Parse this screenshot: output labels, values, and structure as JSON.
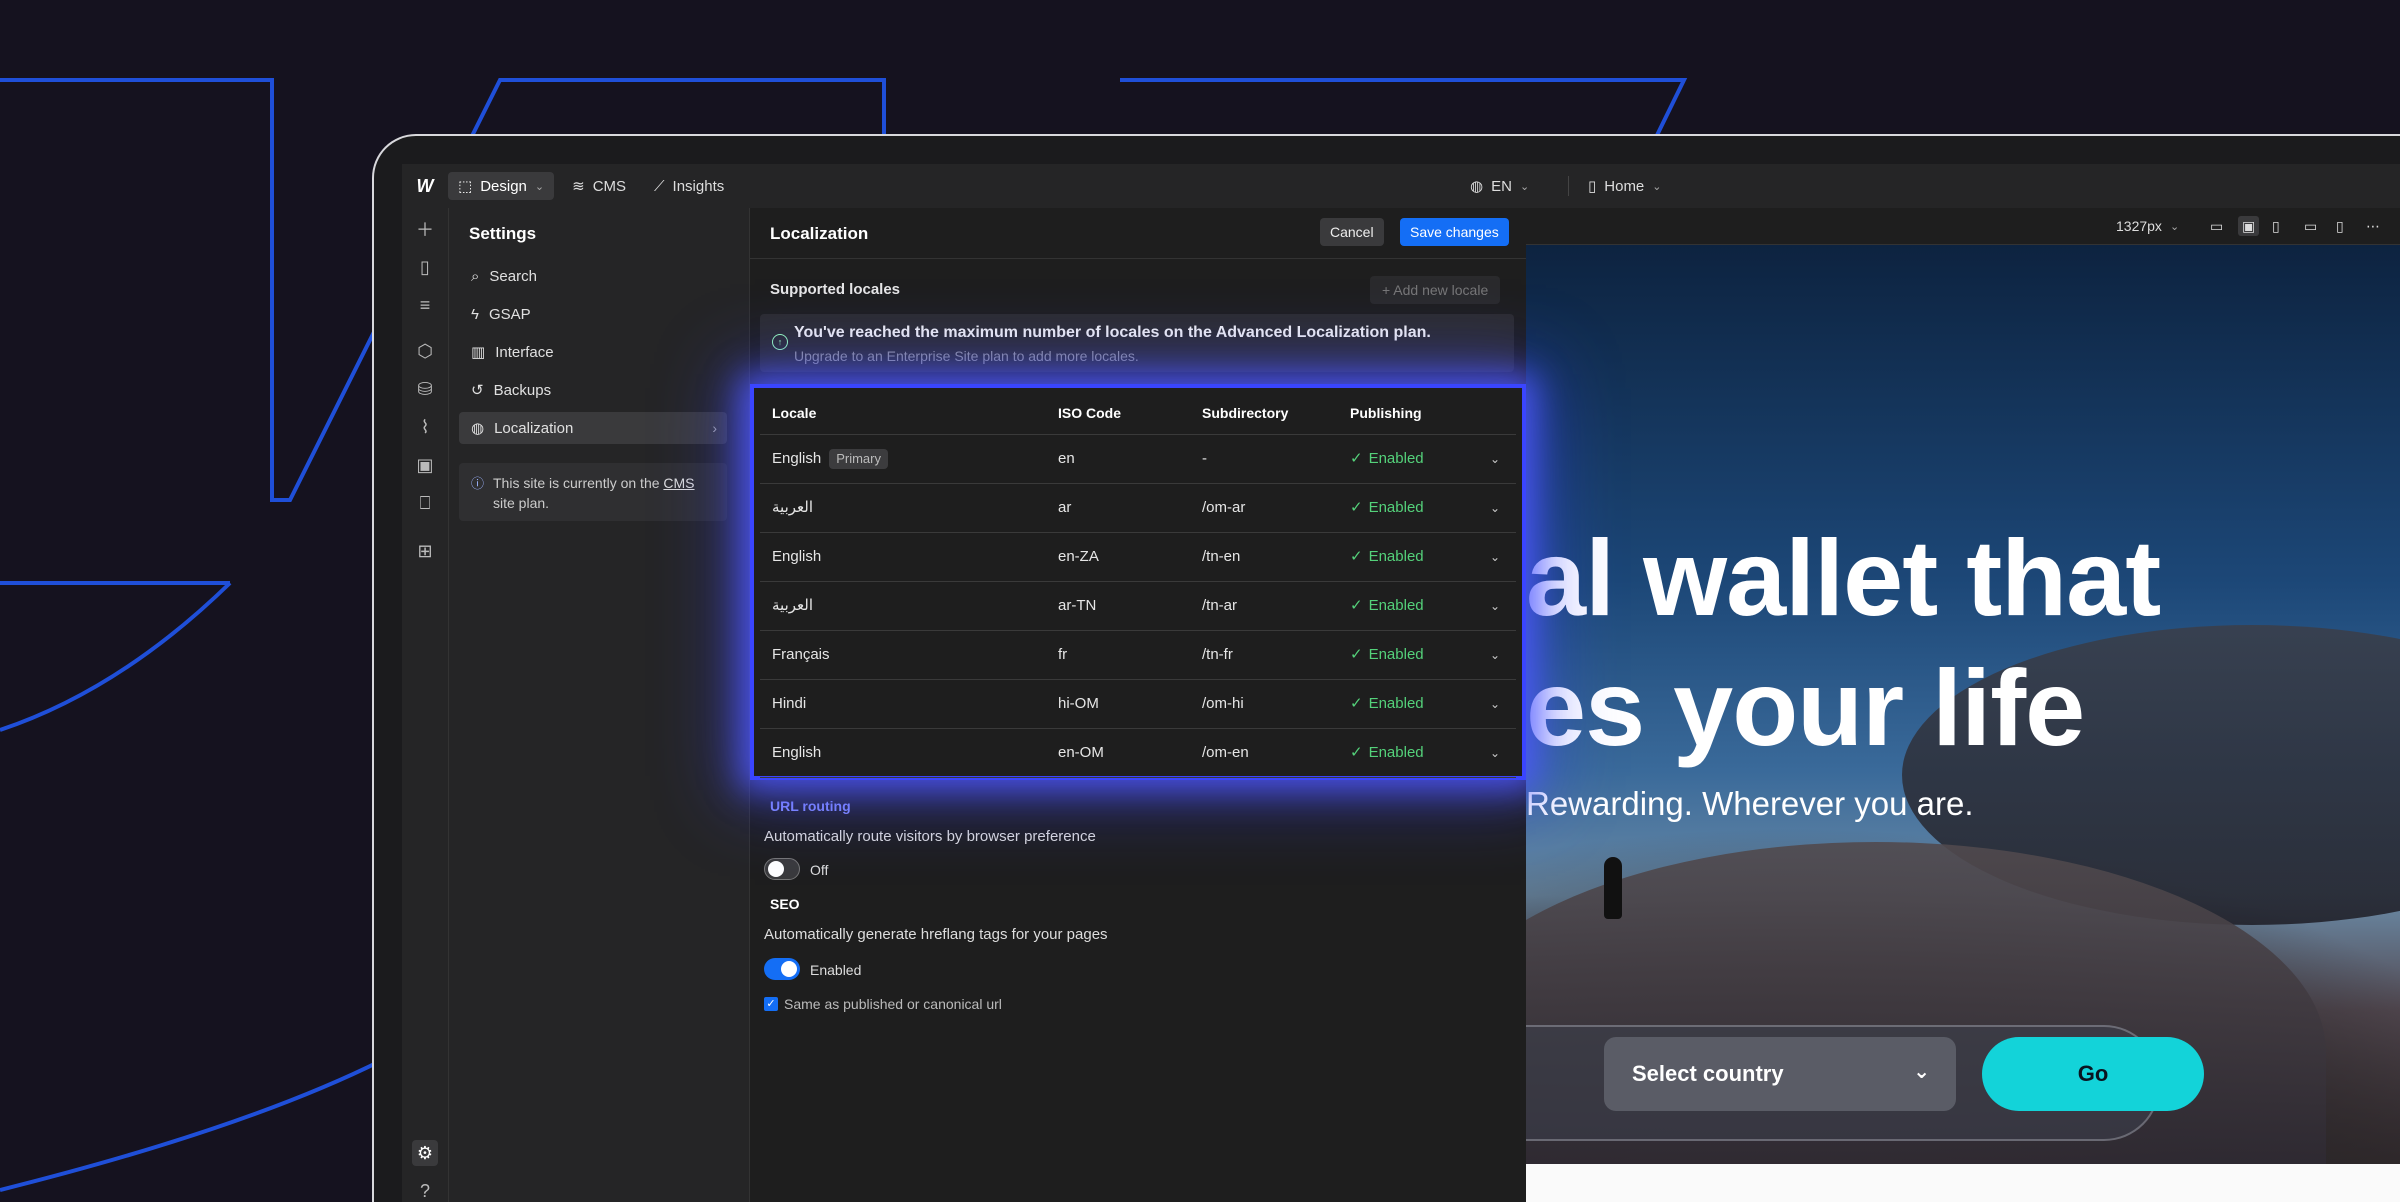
{
  "topbar": {
    "logo": "W",
    "design_label": "Design",
    "cms_label": "CMS",
    "insights_label": "Insights",
    "locale_label": "EN",
    "page_label": "Home"
  },
  "settings": {
    "title": "Settings",
    "items": [
      {
        "label": "Search"
      },
      {
        "label": "GSAP"
      },
      {
        "label": "Interface"
      },
      {
        "label": "Backups"
      },
      {
        "label": "Localization"
      }
    ],
    "notice_pre": "This site is currently on the ",
    "notice_link": "CMS",
    "notice_post": " site plan."
  },
  "localization": {
    "title": "Localization",
    "cancel_label": "Cancel",
    "save_label": "Save changes",
    "supported_label": "Supported locales",
    "add_locale_label": "+ Add new locale",
    "warning_title": "You've reached the maximum number of locales on the Advanced Localization plan.",
    "warning_sub": "Upgrade to an Enterprise Site plan to add more locales.",
    "table": {
      "headers": [
        "Locale",
        "ISO Code",
        "Subdirectory",
        "Publishing"
      ],
      "primary_badge": "Primary",
      "rows": [
        {
          "locale": "English",
          "iso": "en",
          "sub": "-",
          "status": "Enabled"
        },
        {
          "locale": "العربية",
          "iso": "ar",
          "sub": "/om-ar",
          "status": "Enabled"
        },
        {
          "locale": "English",
          "iso": "en-ZA",
          "sub": "/tn-en",
          "status": "Enabled"
        },
        {
          "locale": "العربية",
          "iso": "ar-TN",
          "sub": "/tn-ar",
          "status": "Enabled"
        },
        {
          "locale": "Français",
          "iso": "fr",
          "sub": "/tn-fr",
          "status": "Enabled"
        },
        {
          "locale": "Hindi",
          "iso": "hi-OM",
          "sub": "/om-hi",
          "status": "Enabled"
        },
        {
          "locale": "English",
          "iso": "en-OM",
          "sub": "/om-en",
          "status": "Enabled"
        }
      ]
    },
    "url_routing_label": "URL routing",
    "url_routing_desc": "Automatically route visitors by browser preference",
    "url_routing_state": "Off",
    "seo_label": "SEO",
    "seo_desc": "Automatically generate hreflang tags for your pages",
    "seo_state": "Enabled",
    "canonical_label": "Same as published or canonical url"
  },
  "canvas": {
    "width_label": "1327px",
    "hero_line1": "al wallet that",
    "hero_line2": "es your life",
    "hero_sub": "Rewarding. Wherever you are.",
    "select_label": "Select country",
    "go_label": "Go"
  },
  "colors": {
    "accent": "#146ef5",
    "highlight": "#3a45ff",
    "enabled": "#54d17a",
    "go_button": "#13d3d9"
  }
}
